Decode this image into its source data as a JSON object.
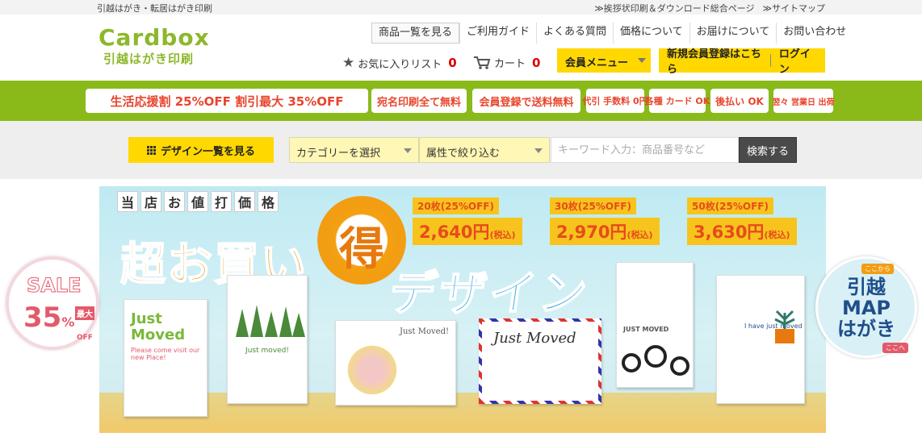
{
  "topbar": {
    "tagline": "引越はがき・転居はがき印刷",
    "links": [
      "≫挨拶状印刷＆ダウンロード総合ページ",
      "≫サイトマップ"
    ]
  },
  "header": {
    "logo_brand": "Cardbox",
    "logo_sub": "引越はがき印刷",
    "nav": [
      "商品一覧を見る",
      "ご利用ガイド",
      "よくある質問",
      "価格について",
      "お届けについて",
      "お問い合わせ"
    ],
    "favorites_label": "お気に入りリスト",
    "favorites_count": "0",
    "cart_label": "カート",
    "cart_count": "0",
    "member_menu": "会員メニュー",
    "signup": "新規会員登録はこちら",
    "login": "ログイン"
  },
  "promo": {
    "chips": [
      "生活応援割 25%OFF 割引最大 35%OFF",
      "宛名印刷全て無料",
      "会員登録で送料無料",
      "代引 手数料 0円",
      "各種 カード OK",
      "後払い OK",
      "翌々 営業日 出荷"
    ]
  },
  "search": {
    "design_button": "デザイン一覧を見る",
    "category_select": "カテゴリーを選択",
    "attribute_select": "属性で絞り込む",
    "keyword_placeholder": "キーワード入力：商品番号など",
    "search_button": "検索する"
  },
  "hero": {
    "header_chars": [
      "当",
      "店",
      "お",
      "値",
      "打",
      "価",
      "格"
    ],
    "title_part1": "超お買い",
    "title_sun": "得",
    "title_part2": "デザイン",
    "prices": [
      {
        "qty": "20枚(25%OFF)",
        "price": "2,640円",
        "tax": "(税込)"
      },
      {
        "qty": "30枚(25%OFF)",
        "price": "2,970円",
        "tax": "(税込)"
      },
      {
        "qty": "50枚(25%OFF)",
        "price": "3,630円",
        "tax": "(税込)"
      }
    ],
    "cards": [
      {
        "title": "Just Moved",
        "sub": "Please come visit our new Place!"
      },
      {
        "title": "Just moved!",
        "sub": ""
      },
      {
        "title": "Just Moved!",
        "sub": ""
      },
      {
        "title": "Just Moved",
        "sub": ""
      },
      {
        "title": "JUST MOVED",
        "sub": ""
      },
      {
        "title": "I have just moved",
        "sub": ""
      }
    ]
  },
  "badges": {
    "sale_word": "SALE",
    "sale_max": "最大",
    "sale_pct": "35",
    "sale_pct_sign": "%",
    "sale_off": "OFF",
    "map_tag_top": "ここから",
    "map_line1": "引越",
    "map_line2": "MAP",
    "map_line3": "はがき",
    "map_tag_bottom": "ここへ"
  },
  "colors": {
    "brand_green": "#8cb82b",
    "promo_green": "#8aba1a",
    "accent_yellow": "#ffd800",
    "count_red": "#dd0000"
  }
}
